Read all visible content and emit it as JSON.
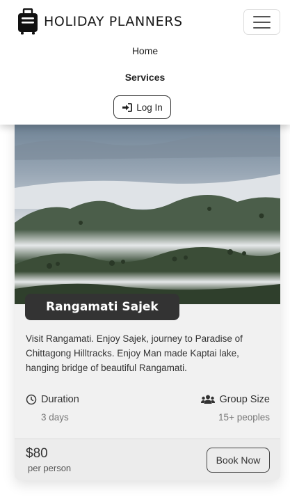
{
  "brand": {
    "name": "HOLIDAY PLANNERS",
    "logo_icon": "suitcase-icon"
  },
  "nav": {
    "toggle_icon": "hamburger-icon",
    "links": [
      {
        "label": "Home"
      },
      {
        "label": "Services"
      }
    ],
    "login": {
      "label": "Log In",
      "icon": "sign-in-icon"
    }
  },
  "card": {
    "image_alt": "foggy-hills-photo",
    "title": "Rangamati Sajek",
    "description": "Visit Rangamati. Enjoy Sajek, journey to Paradise of Chittagong Hilltracks. Enjoy Man made Kaptai lake, hanging bridge of beautiful Rangamati.",
    "duration": {
      "label": "Duration",
      "value": "3 days",
      "icon": "clock-icon"
    },
    "group_size": {
      "label": "Group Size",
      "value": "15+ peoples",
      "icon": "users-icon"
    },
    "price": "$80",
    "price_unit": "per person",
    "book_label": "Book Now"
  },
  "colors": {
    "badge": "#333333",
    "card_bg": "#f1f1f1",
    "footer_bg": "#ececec"
  }
}
